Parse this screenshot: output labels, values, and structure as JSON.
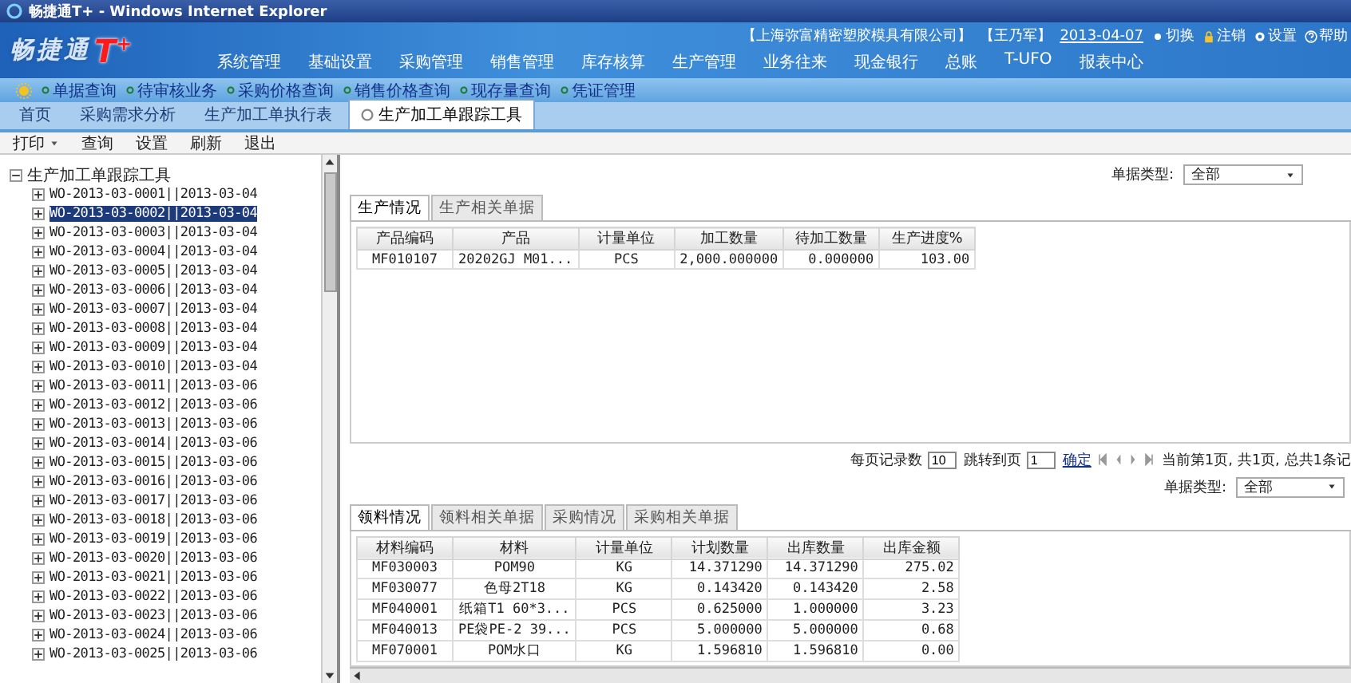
{
  "window": {
    "title": "畅捷通T+ - Windows Internet Explorer"
  },
  "header": {
    "logo_text": "畅捷通",
    "logo_mark": "T$^{+}$",
    "company": "【上海弥富精密塑胶模具有限公司】",
    "user": "【王乃军】",
    "date": "2013-04-07",
    "actions": [
      {
        "kind": "switch",
        "label": "切换"
      },
      {
        "kind": "lock",
        "label": "注销"
      },
      {
        "kind": "settings",
        "label": "设置"
      },
      {
        "kind": "help",
        "label": "帮助"
      }
    ]
  },
  "nav": [
    "系统管理",
    "基础设置",
    "采购管理",
    "销售管理",
    "库存核算",
    "生产管理",
    "业务往来",
    "现金银行",
    "总账",
    "T-UFO",
    "报表中心"
  ],
  "quick_links": [
    "单据查询",
    "待审核业务",
    "采购价格查询",
    "销售价格查询",
    "现存量查询",
    "凭证管理"
  ],
  "tabs": [
    {
      "label": "首页",
      "selected": false
    },
    {
      "label": "采购需求分析",
      "selected": false
    },
    {
      "label": "生产加工单执行表",
      "selected": false
    },
    {
      "label": "生产加工单跟踪工具",
      "selected": true
    }
  ],
  "toolbar": [
    {
      "label": "打印",
      "dropdown": true
    },
    {
      "label": "查询",
      "dropdown": false
    },
    {
      "label": "设置",
      "dropdown": false
    },
    {
      "label": "刷新",
      "dropdown": false
    },
    {
      "label": "退出",
      "dropdown": false
    }
  ],
  "tree": {
    "label": "生产加工单跟踪工具",
    "expanded": true,
    "children": [
      {
        "label": "WO-2013-03-0001||2013-03-04",
        "selected": false,
        "expanded": false
      },
      {
        "label": "WO-2013-03-0002||2013-03-04",
        "selected": true,
        "expanded": false
      },
      {
        "label": "WO-2013-03-0003||2013-03-04",
        "selected": false,
        "expanded": false
      },
      {
        "label": "WO-2013-03-0004||2013-03-04",
        "selected": false,
        "expanded": false
      },
      {
        "label": "WO-2013-03-0005||2013-03-04",
        "selected": false,
        "expanded": false
      },
      {
        "label": "WO-2013-03-0006||2013-03-04",
        "selected": false,
        "expanded": false
      },
      {
        "label": "WO-2013-03-0007||2013-03-04",
        "selected": false,
        "expanded": false
      },
      {
        "label": "WO-2013-03-0008||2013-03-04",
        "selected": false,
        "expanded": false
      },
      {
        "label": "WO-2013-03-0009||2013-03-04",
        "selected": false,
        "expanded": false
      },
      {
        "label": "WO-2013-03-0010||2013-03-04",
        "selected": false,
        "expanded": false
      },
      {
        "label": "WO-2013-03-0011||2013-03-06",
        "selected": false,
        "expanded": false
      },
      {
        "label": "WO-2013-03-0012||2013-03-06",
        "selected": false,
        "expanded": false
      },
      {
        "label": "WO-2013-03-0013||2013-03-06",
        "selected": false,
        "expanded": false
      },
      {
        "label": "WO-2013-03-0014||2013-03-06",
        "selected": false,
        "expanded": false
      },
      {
        "label": "WO-2013-03-0015||2013-03-06",
        "selected": false,
        "expanded": false
      },
      {
        "label": "WO-2013-03-0016||2013-03-06",
        "selected": false,
        "expanded": false
      },
      {
        "label": "WO-2013-03-0017||2013-03-06",
        "selected": false,
        "expanded": false
      },
      {
        "label": "WO-2013-03-0018||2013-03-06",
        "selected": false,
        "expanded": false
      },
      {
        "label": "WO-2013-03-0019||2013-03-06",
        "selected": false,
        "expanded": false
      },
      {
        "label": "WO-2013-03-0020||2013-03-06",
        "selected": false,
        "expanded": false
      },
      {
        "label": "WO-2013-03-0021||2013-03-06",
        "selected": false,
        "expanded": false
      },
      {
        "label": "WO-2013-03-0022||2013-03-06",
        "selected": false,
        "expanded": false
      },
      {
        "label": "WO-2013-03-0023||2013-03-06",
        "selected": false,
        "expanded": false
      },
      {
        "label": "WO-2013-03-0024||2013-03-06",
        "selected": false,
        "expanded": false
      },
      {
        "label": "WO-2013-03-0025||2013-03-06",
        "selected": false,
        "expanded": false
      }
    ]
  },
  "production": {
    "filter": {
      "label": "单据类型:",
      "value": "全部"
    },
    "tabs": [
      {
        "label": "生产情况",
        "selected": true
      },
      {
        "label": "生产相关单据",
        "selected": false
      }
    ],
    "columns": [
      "产品编码",
      "产品",
      "计量单位",
      "加工数量",
      "待加工数量",
      "生产进度%"
    ],
    "rows": [
      [
        "MF010107",
        "20202GJ M01...",
        "PCS",
        "2,000.000000",
        "0.000000",
        "103.00"
      ]
    ]
  },
  "pagination": {
    "page_size_label": "每页记录数",
    "page_size": "10",
    "jump_label": "跳转到页",
    "page": "1",
    "confirm": "确定",
    "status": "当前第1页, 共1页, 总共1条记"
  },
  "materials": {
    "filter": {
      "label": "单据类型:",
      "value": "全部"
    },
    "tabs": [
      {
        "label": "领料情况",
        "selected": true
      },
      {
        "label": "领料相关单据",
        "selected": false
      },
      {
        "label": "采购情况",
        "selected": false
      },
      {
        "label": "采购相关单据",
        "selected": false
      }
    ],
    "columns": [
      "材料编码",
      "材料",
      "计量单位",
      "计划数量",
      "出库数量",
      "出库金额"
    ],
    "rows": [
      [
        "MF030003",
        "POM90",
        "KG",
        "14.371290",
        "14.371290",
        "275.02"
      ],
      [
        "MF030077",
        "色母2T18",
        "KG",
        "0.143420",
        "0.143420",
        "2.58"
      ],
      [
        "MF040001",
        "纸箱T1 60*3...",
        "PCS",
        "0.625000",
        "1.000000",
        "3.23"
      ],
      [
        "MF040013",
        "PE袋PE-2 39...",
        "PCS",
        "5.000000",
        "5.000000",
        "0.68"
      ],
      [
        "MF070001",
        "POM水口",
        "KG",
        "1.596810",
        "1.596810",
        "0.00"
      ]
    ]
  }
}
